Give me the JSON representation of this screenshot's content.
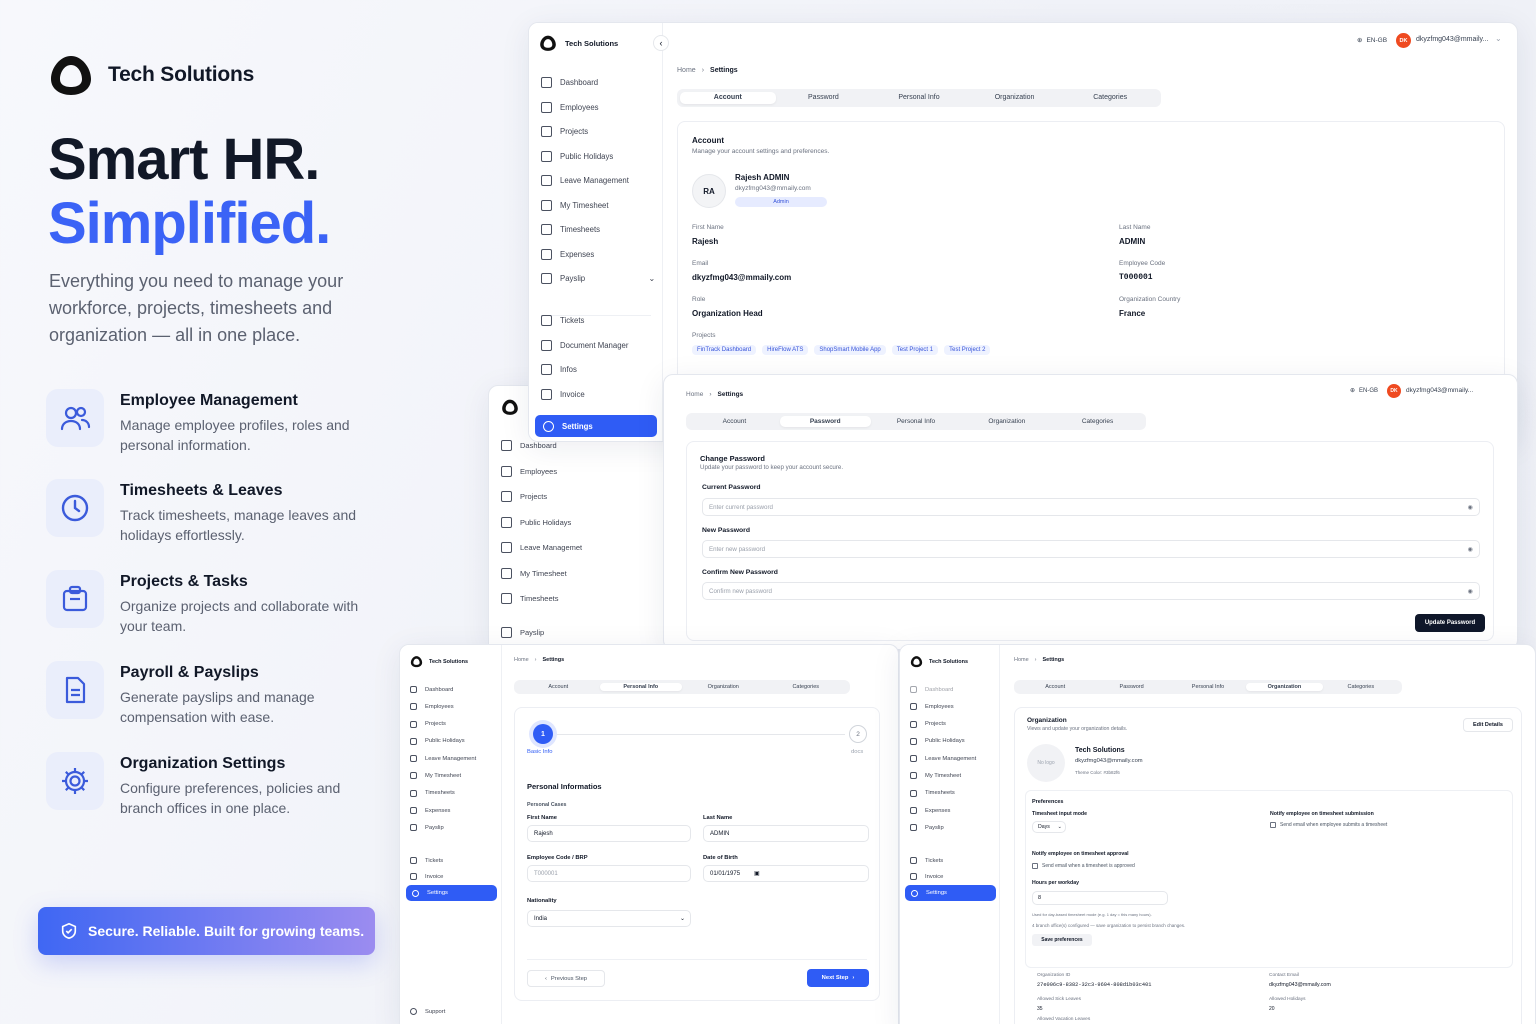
{
  "brand": {
    "name": "Tech Solutions",
    "title_line1": "Smart HR.",
    "title_line2": "Simplified.",
    "lead": "Everything you need to manage your workforce, projects, timesheets and organization — all in one place."
  },
  "features": [
    {
      "icon": "users-icon",
      "title": "Employee Management",
      "desc": "Manage employee profiles, roles and personal information."
    },
    {
      "icon": "clock-icon",
      "title": "Timesheets & Leaves",
      "desc": "Track timesheets, manage leaves and holidays effortlessly."
    },
    {
      "icon": "clipboard-icon",
      "title": "Projects & Tasks",
      "desc": "Organize projects and collaborate with your team."
    },
    {
      "icon": "file-icon",
      "title": "Payroll & Payslips",
      "desc": "Generate payslips and manage compensation with ease."
    },
    {
      "icon": "gear-icon",
      "title": "Organization Settings",
      "desc": "Configure preferences, policies and branch offices in one place."
    }
  ],
  "banner": "Secure. Reliable. Built for growing teams.",
  "sidebar": {
    "brand": "Tech Solutions",
    "items": [
      "Dashboard",
      "Employees",
      "Projects",
      "Public Holidays",
      "Leave Management",
      "My Timesheet",
      "Timesheets",
      "Expenses",
      "Payslip"
    ],
    "items2": [
      "Tickets",
      "Document Manager",
      "Infos",
      "Invoice"
    ],
    "settings": "Settings",
    "support": "Support",
    "mid_items": [
      "Dashboard",
      "Employees",
      "Projects",
      "Public Holidays",
      "Leave Managemet",
      "My Timesheet",
      "Timesheets",
      "Payslip"
    ]
  },
  "topbar": {
    "lang": "EN-GB",
    "avatar": "DK",
    "email": "dkyzfmg043@mmaily..."
  },
  "crumb": {
    "home": "Home",
    "current": "Settings"
  },
  "tabs": [
    "Account",
    "Password",
    "Personal Info",
    "Organization",
    "Categories"
  ],
  "account": {
    "title": "Account",
    "subtitle": "Manage your account settings and preferences.",
    "initials": "RA",
    "name": "Rajesh ADMIN",
    "email": "dkyzfmg043@mmaily.com",
    "role_badge": "Admin",
    "first_name_label": "First Name",
    "first_name": "Rajesh",
    "last_name_label": "Last Name",
    "last_name": "ADMIN",
    "email_label": "Email",
    "email_value": "dkyzfmg043@mmaily.com",
    "code_label": "Employee Code",
    "code": "T000001",
    "role_label": "Role",
    "role": "Organization Head",
    "country_label": "Organization Country",
    "country": "France",
    "projects_label": "Projects",
    "projects": [
      "FinTrack Dashboard",
      "HireFlow ATS",
      "ShopSmart Mobile App",
      "Test Project 1",
      "Test Project 2"
    ]
  },
  "password": {
    "title": "Change Password",
    "subtitle": "Update your password to keep your account secure.",
    "current_label": "Current Password",
    "current_ph": "Enter current password",
    "new_label": "New Password",
    "new_ph": "Enter new password",
    "confirm_label": "Confirm New Password",
    "confirm_ph": "Confirm new password",
    "button": "Update Password"
  },
  "personal": {
    "step1": "1",
    "step1_label": "Basic Info",
    "step2": "2",
    "step2_label": "docs",
    "section": "Personal Informatios",
    "subsection": "Personal Cases",
    "first_name_label": "First Name",
    "first_name": "Rajesh",
    "last_name_label": "Last Name",
    "last_name": "ADMIN",
    "code_label": "Employee Code / BRP",
    "code": "T000001",
    "dob_label": "Date of Birth",
    "dob": "01/01/1975",
    "nationality_label": "Nationality",
    "nationality": "India",
    "prev": "Previous Step",
    "next": "Next Step"
  },
  "org": {
    "title": "Organization",
    "subtitle": "Views and update your organization details.",
    "edit": "Edit Details",
    "no_logo": "No logo",
    "name": "Tech Solutions",
    "email": "dkyzfmg043@mmaily.com",
    "theme": "Theme Color: #3b82f6",
    "prefs": "Preferences",
    "ts_mode_label": "Timesheet input mode",
    "ts_mode": "Days",
    "notify_sub_label": "Notify employee on timesheet submission",
    "notify_sub": "Send email when employee submits a timesheet",
    "notify_app_label": "Notify employee on timesheet approval",
    "notify_app": "Send email when a timesheet is approved",
    "hours_label": "Hours per workday",
    "hours": "8",
    "hint1": "Used for day-based timesheet mode (e.g. 1 day = this many hours).",
    "hint2": "4 branch office(s) configured — save organization to persist branch changes.",
    "save": "Save preferences",
    "org_id_label": "Organization ID",
    "org_id": "27e006c9-8382-32c3-9604-808d1b03c401",
    "contact_label": "Contact Email",
    "contact": "dkyzfmg043@mmaily.com",
    "sick_label": "Allowed Sick Leaves",
    "sick": "35",
    "hol_label": "Allowed Holidays",
    "hol": "20",
    "vac_label": "Allowed Vacation Leaves"
  }
}
